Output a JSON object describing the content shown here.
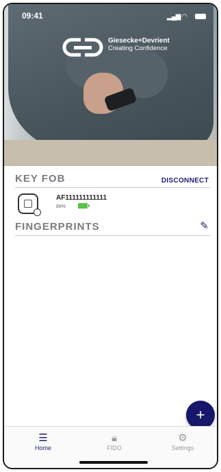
{
  "status": {
    "time": "09:41"
  },
  "brand": {
    "name": "Giesecke+Devrient",
    "tagline": "Creating Confidence"
  },
  "keyfob": {
    "title": "KEY FOB",
    "disconnect_label": "DISCONNECT",
    "device_name": "AF111111111111",
    "battery_percent": "89%"
  },
  "fingerprints": {
    "title": "FINGERPRINTS"
  },
  "fab": {
    "label": "+"
  },
  "tabs": [
    {
      "label": "Home"
    },
    {
      "label": "FIDO"
    },
    {
      "label": "Settings"
    }
  ],
  "colors": {
    "accent": "#1b1f6b",
    "battery": "#5cc24a"
  }
}
